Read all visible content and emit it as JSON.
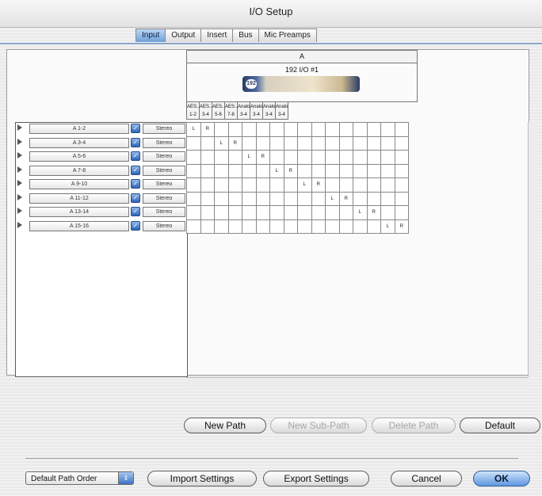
{
  "window": {
    "title": "I/O Setup"
  },
  "tabs": [
    "Input",
    "Output",
    "Insert",
    "Bus",
    "Mic Preamps"
  ],
  "active_tab": "Input",
  "device": {
    "letter": "A",
    "name": "192 I/O #1",
    "logo": "192"
  },
  "channels": [
    {
      "name": "AES...",
      "pair": "1-2"
    },
    {
      "name": "AES...",
      "pair": "3-4"
    },
    {
      "name": "AES...",
      "pair": "5-6"
    },
    {
      "name": "AES...",
      "pair": "7-8"
    },
    {
      "name": "Analog",
      "pair": "3-4"
    },
    {
      "name": "Analog",
      "pair": "3-4"
    },
    {
      "name": "Analog",
      "pair": "3-4"
    },
    {
      "name": "Analog",
      "pair": "3-4"
    }
  ],
  "paths": [
    {
      "name": "A 1-2",
      "format": "Stereo"
    },
    {
      "name": "A 3-4",
      "format": "Stereo"
    },
    {
      "name": "A 5-6",
      "format": "Stereo"
    },
    {
      "name": "A 7-8",
      "format": "Stereo"
    },
    {
      "name": "A 9-10",
      "format": "Stereo"
    },
    {
      "name": "A 11-12",
      "format": "Stereo"
    },
    {
      "name": "A 13-14",
      "format": "Stereo"
    },
    {
      "name": "A 15-16",
      "format": "Stereo"
    }
  ],
  "labels": {
    "left": "L",
    "right": "R"
  },
  "buttons": {
    "new_path": "New Path",
    "new_sub_path": "New Sub-Path",
    "delete_path": "Delete Path",
    "default": "Default",
    "import": "Import Settings",
    "export": "Export Settings",
    "cancel": "Cancel",
    "ok": "OK"
  },
  "path_order": {
    "selected": "Default Path Order"
  }
}
